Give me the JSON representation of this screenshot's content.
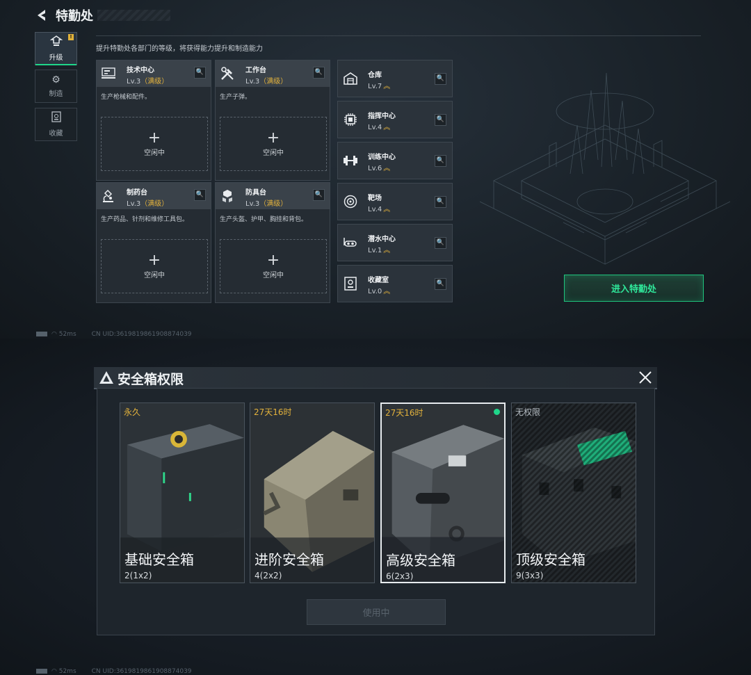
{
  "header": {
    "title": "特勤处",
    "subtitle": "提升特勤处各部门的等级，将获得能力提升和制造能力"
  },
  "tabs": [
    {
      "label": "升级",
      "icon": "upgrade-icon",
      "badge": "!"
    },
    {
      "label": "制造",
      "icon": "gear-icon"
    },
    {
      "label": "收藏",
      "icon": "collection-icon"
    }
  ],
  "departments": [
    {
      "name": "技术中心",
      "level": "Lv.3",
      "max": "（满级）",
      "desc": "生产枪械和配件。",
      "slot": "空闲中",
      "icon": "workstation-icon"
    },
    {
      "name": "工作台",
      "level": "Lv.3",
      "max": "（满级）",
      "desc": "生产子弹。",
      "slot": "空闲中",
      "icon": "tools-icon"
    },
    {
      "name": "制药台",
      "level": "Lv.3",
      "max": "（满级）",
      "desc": "生产药品、针剂和维修工具包。",
      "slot": "空闲中",
      "icon": "microscope-icon"
    },
    {
      "name": "防具台",
      "level": "Lv.3",
      "max": "（满级）",
      "desc": "生产头盔、护甲、胸挂和背包。",
      "slot": "空闲中",
      "icon": "armor-icon"
    }
  ],
  "facilities": [
    {
      "name": "仓库",
      "level": "Lv.7",
      "icon": "warehouse-icon"
    },
    {
      "name": "指挥中心",
      "level": "Lv.4",
      "icon": "chip-icon"
    },
    {
      "name": "训练中心",
      "level": "Lv.6",
      "icon": "dumbbell-icon"
    },
    {
      "name": "靶场",
      "level": "Lv.4",
      "icon": "target-icon"
    },
    {
      "name": "潜水中心",
      "level": "Lv.1",
      "icon": "diving-icon"
    },
    {
      "name": "收藏室",
      "level": "Lv.0",
      "icon": "collection-icon"
    }
  ],
  "enter_button": "进入特勤处",
  "status_bar": {
    "ping": "52ms",
    "uid": "CN UID:3619819861908874039"
  },
  "dialog": {
    "title": "安全箱权限",
    "use_button": "使用中",
    "boxes": [
      {
        "name": "基础安全箱",
        "size": "2(1x2)",
        "time": "永久",
        "tone": "#3a4147"
      },
      {
        "name": "进阶安全箱",
        "size": "4(2x2)",
        "time": "27天16时",
        "tone": "#8a8672"
      },
      {
        "name": "高级安全箱",
        "size": "6(2x3)",
        "time": "27天16时",
        "tone": "#565c61",
        "selected": true
      },
      {
        "name": "顶级安全箱",
        "size": "9(3x3)",
        "time": "无权限",
        "tone": "#2f3539"
      }
    ]
  },
  "colors": {
    "accent": "#1fd68a",
    "gold": "#e3b23c"
  }
}
